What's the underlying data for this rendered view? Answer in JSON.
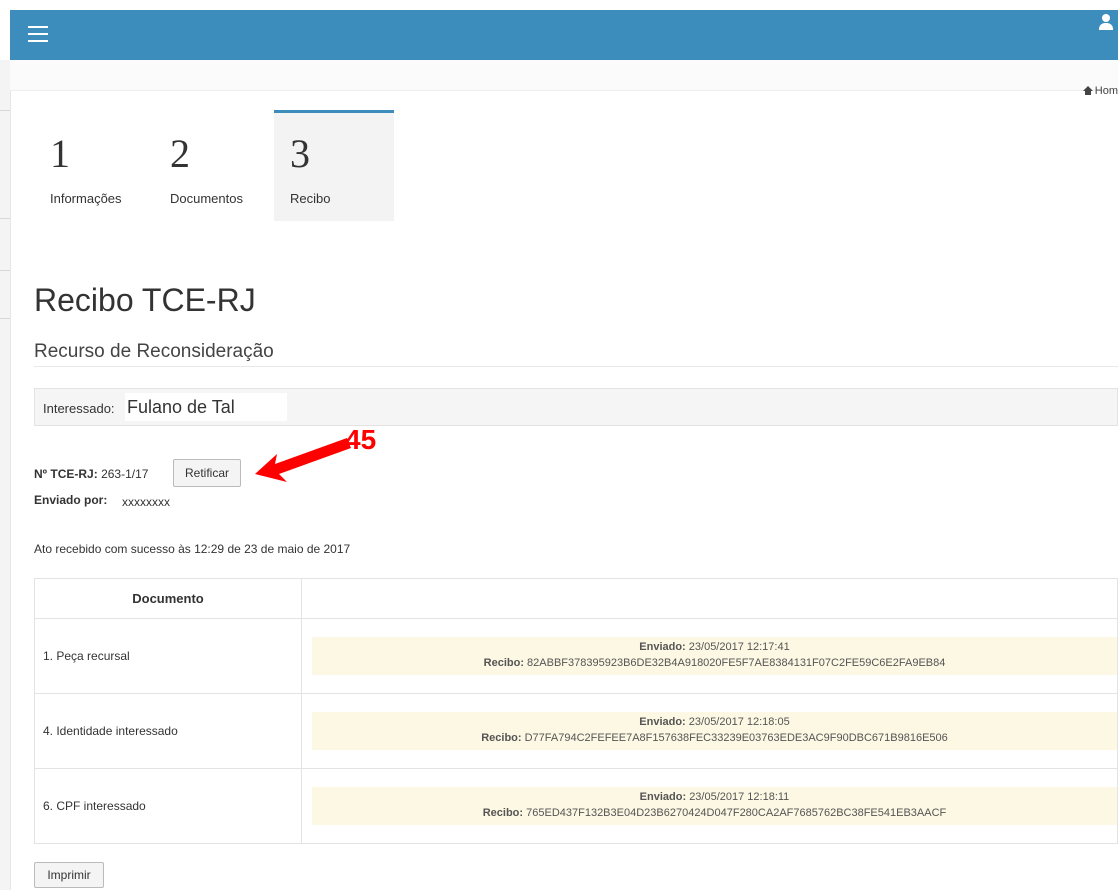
{
  "header": {
    "menu_icon": "hamburger-icon",
    "user_icon": "user-icon",
    "accent": "#3c8dbc"
  },
  "breadcrumb": {
    "home_label": "Hom",
    "icon": "home-icon"
  },
  "steps": [
    {
      "number": "1",
      "label": "Informações",
      "active": false
    },
    {
      "number": "2",
      "label": "Documentos",
      "active": false
    },
    {
      "number": "3",
      "label": "Recibo",
      "active": true
    }
  ],
  "page": {
    "title": "Recibo TCE-RJ",
    "subtitle": "Recurso de Reconsideração"
  },
  "interessado": {
    "label": "Interessado:",
    "value": "Fulano de Tal"
  },
  "tce": {
    "label": "Nº TCE-RJ:",
    "value": "263-1/17",
    "retificar_label": "Retificar",
    "enviado_label": "Enviado por:",
    "enviado_value": "xxxxxxxx"
  },
  "annotation": {
    "number": "45",
    "color": "#ff0000"
  },
  "ato_message": "Ato recebido com sucesso às 12:29 de 23 de maio de 2017",
  "table": {
    "headers": [
      "Documento",
      ""
    ],
    "rows": [
      {
        "name": "1. Peça recursal",
        "enviado_label": "Enviado:",
        "enviado": "23/05/2017 12:17:41",
        "recibo_label": "Recibo:",
        "recibo": "82ABBF378395923B6DE32B4A918020FE5F7AE8384131F07C2FE59C6E2FA9EB84"
      },
      {
        "name": "4. Identidade interessado",
        "enviado_label": "Enviado:",
        "enviado": "23/05/2017 12:18:05",
        "recibo_label": "Recibo:",
        "recibo": "D77FA794C2FEFEE7A8F157638FEC33239E03763EDE3AC9F90DBC671B9816E506"
      },
      {
        "name": "6. CPF interessado",
        "enviado_label": "Enviado:",
        "enviado": "23/05/2017 12:18:11",
        "recibo_label": "Recibo:",
        "recibo": "765ED437F132B3E04D23B6270424D047F280CA2AF7685762BC38FE541EB3AACF"
      }
    ]
  },
  "imprimir_label": "Imprimir"
}
